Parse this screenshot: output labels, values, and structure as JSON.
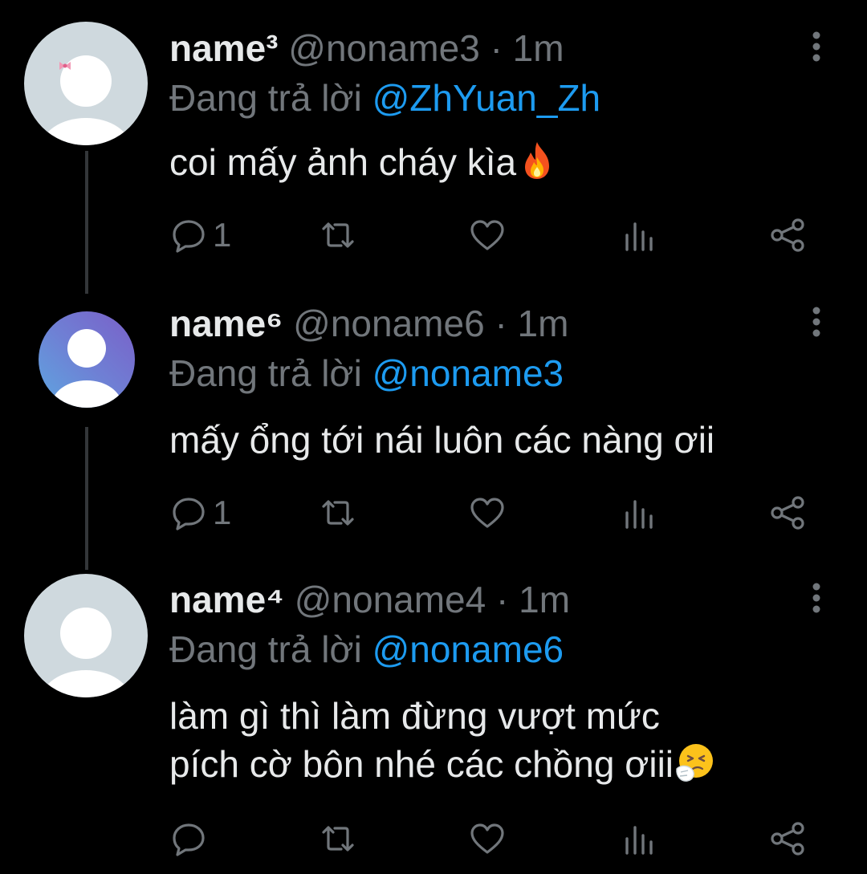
{
  "tweets": [
    {
      "display_name": "name³",
      "handle": "@noname3",
      "time": "1m",
      "reply_prefix": "Đang trả lời",
      "reply_to": "@ZhYuan_Zh",
      "lines": [
        "coi mấy ảnh cháy kìa"
      ],
      "emoji": "fire-emoji",
      "reply_count": "1",
      "avatar": "default-avatar-with-bow"
    },
    {
      "display_name": "name⁶",
      "handle": "@noname6",
      "time": "1m",
      "reply_prefix": "Đang trả lời",
      "reply_to": "@noname3",
      "lines": [
        "mấy ổng tới nái luôn các nàng ơii"
      ],
      "emoji": "",
      "reply_count": "1",
      "avatar": "default-avatar-blue-gradient"
    },
    {
      "display_name": "name⁴",
      "handle": "@noname4",
      "time": "1m",
      "reply_prefix": "Đang trả lời",
      "reply_to": "@noname6",
      "lines": [
        "làm gì thì làm đừng vượt mức",
        "pích cờ bôn nhé các chồng ơiii"
      ],
      "emoji": "sneezing-face-emoji",
      "reply_count": "",
      "avatar": "default-avatar-gray"
    }
  ],
  "separator": "·",
  "colors": {
    "background": "#000000",
    "text": "#e7e9ea",
    "muted": "#71767b",
    "link": "#1d9bf0",
    "thread_line": "#333639"
  }
}
